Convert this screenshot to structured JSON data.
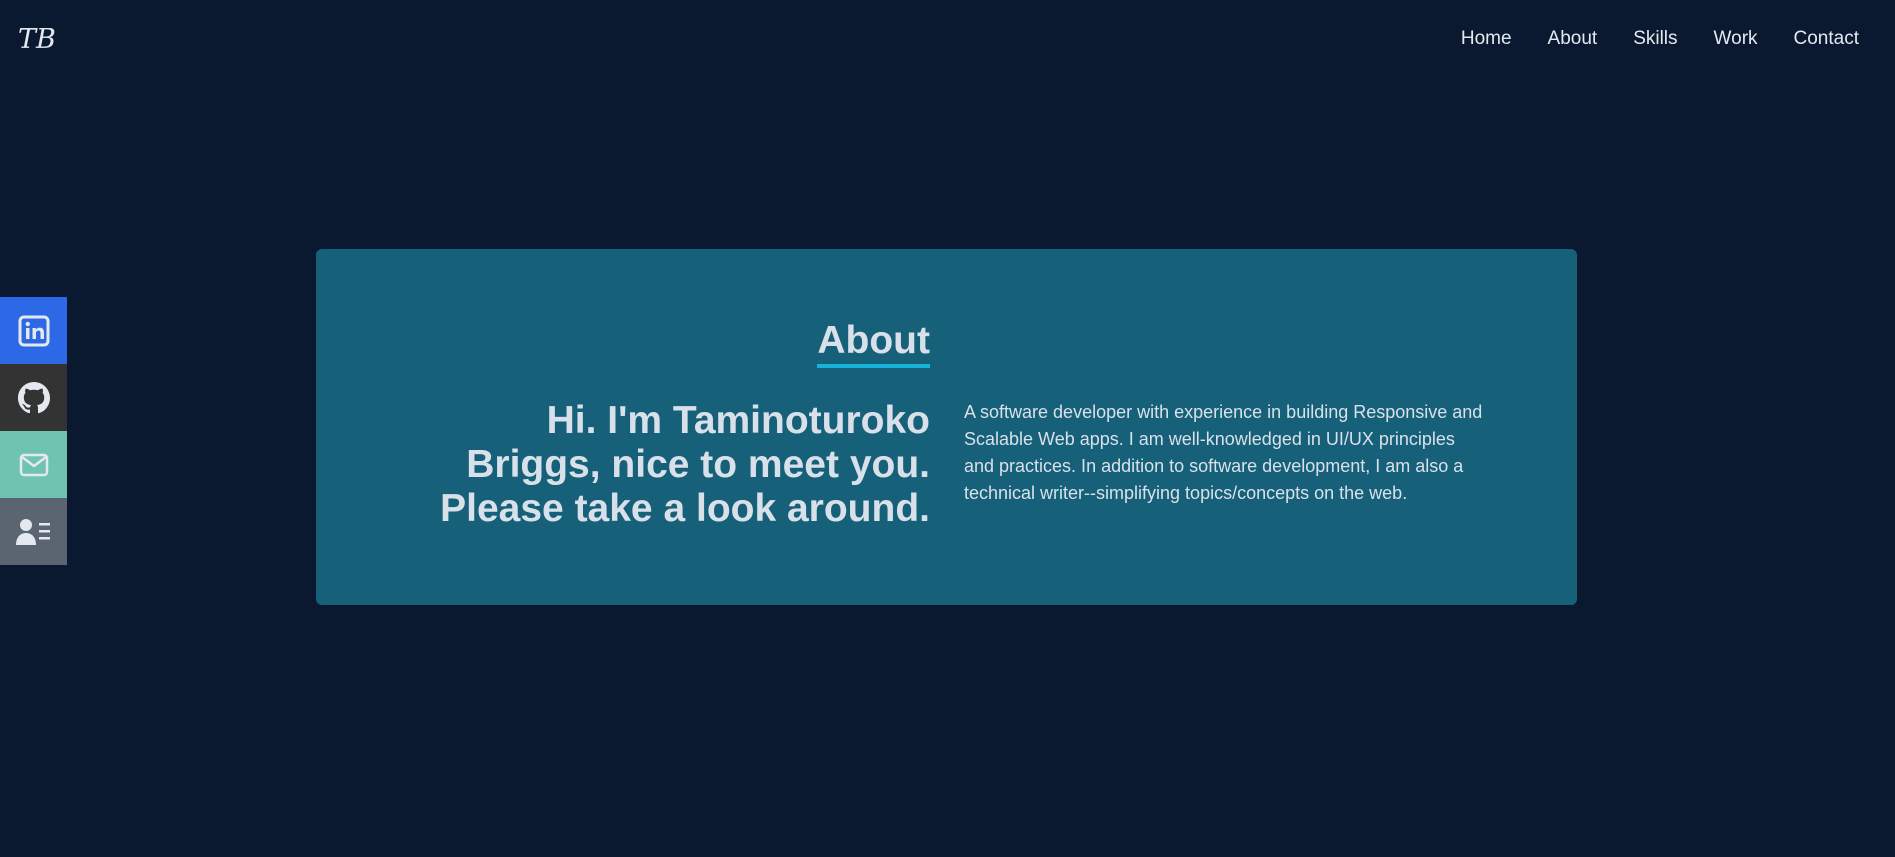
{
  "brand": {
    "logo_text": "TB"
  },
  "nav": {
    "items": [
      "Home",
      "About",
      "Skills",
      "Work",
      "Contact"
    ]
  },
  "social": {
    "items": [
      {
        "icon": "linkedin-icon",
        "color": "#2d69e6"
      },
      {
        "icon": "github-icon",
        "color": "#333333"
      },
      {
        "icon": "mail-icon",
        "color": "#6fc4b0"
      },
      {
        "icon": "contact-card-icon",
        "color": "#5b6571"
      }
    ]
  },
  "about": {
    "title": "About",
    "headline_lines": [
      "Hi. I'm Taminoturoko",
      "Briggs, nice to meet you.",
      "Please take a look around."
    ],
    "description": "A software developer with experience in building Responsive and Scalable Web apps. I am well-knowledged in UI/UX principles and practices. In addition to software development, I am also a technical writer--simplifying topics/concepts on the web."
  },
  "colors": {
    "background": "#0b1930",
    "card": "#176079",
    "accent": "#17b2d8",
    "text": "#d8e1ea"
  }
}
